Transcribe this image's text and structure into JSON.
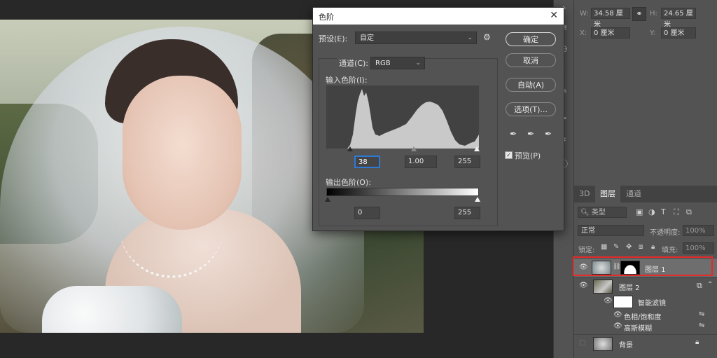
{
  "levels_dialog": {
    "title": "色阶",
    "close": "✕",
    "preset_label": "预设(E):",
    "preset_value": "自定",
    "preset_gear": "⚙",
    "channel_label": "通道(C):",
    "channel_value": "RGB",
    "input_levels_label": "输入色阶(I):",
    "input_black": "38",
    "input_mid": "1.00",
    "input_white": "255",
    "output_levels_label": "输出色阶(O):",
    "output_black": "0",
    "output_white": "255",
    "ok_label": "确定",
    "cancel_label": "取消",
    "auto_label": "自动(A)",
    "options_label": "选项(T)...",
    "preview_label": "预览(P)",
    "preview_checked": true
  },
  "properties": {
    "w_label": "W:",
    "w_value": "34.58 厘米",
    "h_label": "H:",
    "h_value": "24.65 厘米",
    "x_label": "X:",
    "x_value": "0 厘米",
    "y_label": "Y:",
    "y_value": "0 厘米",
    "link_icon": "link-icon"
  },
  "layers_panel": {
    "tabs": [
      "3D",
      "图层",
      "通道"
    ],
    "active_tab": "图层",
    "kind_filter": "类型",
    "blend_mode": "正常",
    "opacity_label": "不透明度:",
    "opacity_value": "100%",
    "lock_label": "锁定:",
    "fill_label": "填充:",
    "fill_value": "100%",
    "layers": [
      {
        "name": "图层 1",
        "selected": true,
        "visible": true,
        "has_mask": true
      },
      {
        "name": "图层 2",
        "selected": false,
        "visible": true,
        "smart_object": true
      },
      {
        "name": "智能滤镜",
        "selected": false,
        "visible": true,
        "sub": true
      },
      {
        "name": "色相/饱和度",
        "selected": false,
        "visible": true,
        "sub": true
      },
      {
        "name": "高斯模糊",
        "selected": false,
        "visible": true,
        "sub": true
      },
      {
        "name": "背景",
        "selected": false,
        "visible": false,
        "locked": true
      }
    ]
  },
  "colors": {
    "highlight_box": "#e52a2a",
    "focus_blue": "#2c7ad6"
  }
}
